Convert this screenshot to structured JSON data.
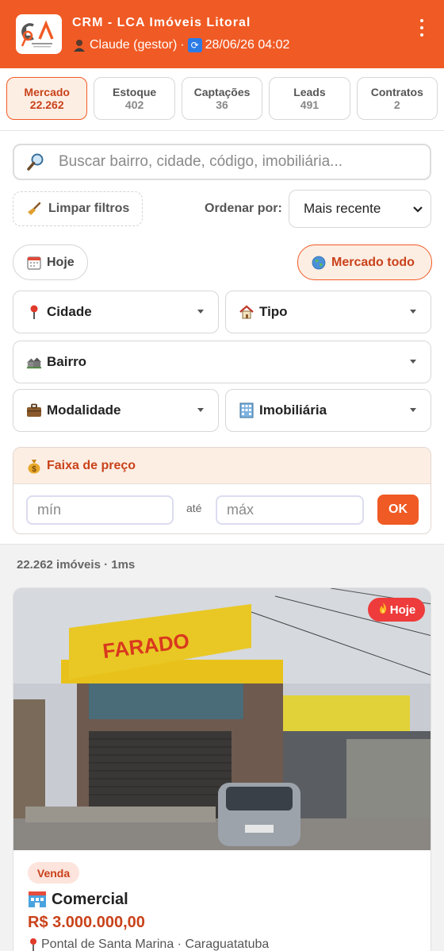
{
  "header": {
    "title": "CRM - LCA Imóveis Litoral",
    "user": "Claude (gestor)",
    "separator": "·",
    "datetime": "28/06/26 04:02",
    "logo_text": "LCA",
    "brand_color": "#f05a24"
  },
  "tabs": [
    {
      "label": "Mercado",
      "count": "22.262",
      "active": true
    },
    {
      "label": "Estoque",
      "count": "402"
    },
    {
      "label": "Captações",
      "count": "36"
    },
    {
      "label": "Leads",
      "count": "491"
    },
    {
      "label": "Contratos",
      "count": "2"
    }
  ],
  "search": {
    "placeholder": "Buscar bairro, cidade, código, imobiliária..."
  },
  "controls": {
    "clear_label": "Limpar filtros",
    "sort_label": "Ordenar por:",
    "sort_value": "Mais recente",
    "today_label": "Hoje",
    "market_label": "Mercado todo"
  },
  "filters": {
    "city": "Cidade",
    "type": "Tipo",
    "neighborhood": "Bairro",
    "modality": "Modalidade",
    "agency": "Imobiliária"
  },
  "price": {
    "title": "Faixa de preço",
    "min_placeholder": "mín",
    "to": "até",
    "max_placeholder": "máx",
    "ok": "OK"
  },
  "results": {
    "summary": "22.262 imóveis · 1ms"
  },
  "listing": {
    "badge": "Hoje",
    "modality": "Venda",
    "type": "Comercial",
    "price": "R$ 3.000.000,00",
    "location": "Pontal de Santa Marina · Caraguatatuba",
    "sign_text": "FARADO"
  },
  "icons": {
    "user": "person-icon",
    "sync": "sync-icon",
    "search": "magnifier-icon",
    "clear": "broom-icon",
    "today": "calendar-icon",
    "market": "globe-icon",
    "city": "pin-icon",
    "type": "house-icon",
    "neighborhood": "houses-icon",
    "modality": "briefcase-icon",
    "agency": "office-building-icon",
    "price": "money-bag-icon",
    "hot": "fire-icon"
  }
}
